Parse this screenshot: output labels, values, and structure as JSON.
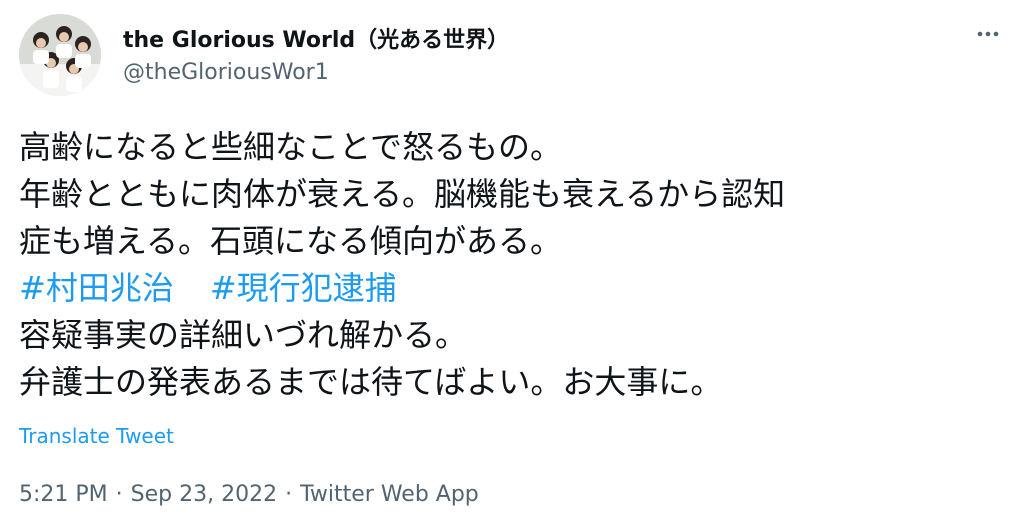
{
  "author": {
    "display_name": "the Glorious World（光ある世界）",
    "handle": "@theGloriousWor1"
  },
  "tweet": {
    "lines": [
      "高齢になると些細なことで怒るもの。",
      "年齢とともに肉体が衰える。脳機能も衰えるから認知",
      "症も増える。石頭になる傾向がある。"
    ],
    "hashtags": [
      "#村田兆治",
      "#現行犯逮捕"
    ],
    "lines_after": [
      "容疑事実の詳細いづれ解かる。",
      "弁護士の発表あるまでは待てばよい。お大事に。"
    ]
  },
  "translate_label": "Translate Tweet",
  "meta": {
    "time": "5:21 PM",
    "separator": "·",
    "date": "Sep 23, 2022",
    "source": "Twitter Web App"
  },
  "colors": {
    "link": "#1d9bf0",
    "secondary_text": "#536471",
    "primary_text": "#0f1419"
  },
  "icons": {
    "more": "more-horizontal-icon"
  }
}
